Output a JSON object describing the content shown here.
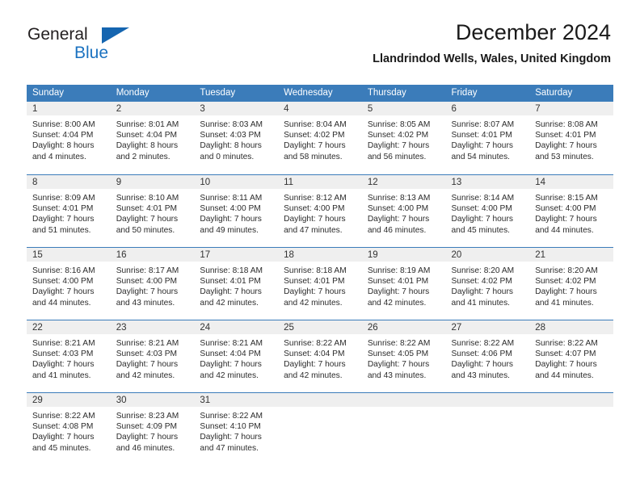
{
  "brand": {
    "word1": "General",
    "word2": "Blue",
    "triangle_color": "#1565b0",
    "word2_color": "#1b72c0"
  },
  "header": {
    "title": "December 2024",
    "subtitle": "Llandrindod Wells, Wales, United Kingdom"
  },
  "colors": {
    "header_bar": "#3b7cba",
    "day_band": "#efefef",
    "row_divider": "#3b7cba",
    "text": "#2b2b2b"
  },
  "weekdays": [
    "Sunday",
    "Monday",
    "Tuesday",
    "Wednesday",
    "Thursday",
    "Friday",
    "Saturday"
  ],
  "labels": {
    "sunrise_prefix": "Sunrise: ",
    "sunset_prefix": "Sunset: ",
    "daylight_prefix": "Daylight: "
  },
  "weeks": [
    [
      {
        "day": "1",
        "sunrise": "Sunrise: 8:00 AM",
        "sunset": "Sunset: 4:04 PM",
        "daylight": "Daylight: 8 hours and 4 minutes."
      },
      {
        "day": "2",
        "sunrise": "Sunrise: 8:01 AM",
        "sunset": "Sunset: 4:04 PM",
        "daylight": "Daylight: 8 hours and 2 minutes."
      },
      {
        "day": "3",
        "sunrise": "Sunrise: 8:03 AM",
        "sunset": "Sunset: 4:03 PM",
        "daylight": "Daylight: 8 hours and 0 minutes."
      },
      {
        "day": "4",
        "sunrise": "Sunrise: 8:04 AM",
        "sunset": "Sunset: 4:02 PM",
        "daylight": "Daylight: 7 hours and 58 minutes."
      },
      {
        "day": "5",
        "sunrise": "Sunrise: 8:05 AM",
        "sunset": "Sunset: 4:02 PM",
        "daylight": "Daylight: 7 hours and 56 minutes."
      },
      {
        "day": "6",
        "sunrise": "Sunrise: 8:07 AM",
        "sunset": "Sunset: 4:01 PM",
        "daylight": "Daylight: 7 hours and 54 minutes."
      },
      {
        "day": "7",
        "sunrise": "Sunrise: 8:08 AM",
        "sunset": "Sunset: 4:01 PM",
        "daylight": "Daylight: 7 hours and 53 minutes."
      }
    ],
    [
      {
        "day": "8",
        "sunrise": "Sunrise: 8:09 AM",
        "sunset": "Sunset: 4:01 PM",
        "daylight": "Daylight: 7 hours and 51 minutes."
      },
      {
        "day": "9",
        "sunrise": "Sunrise: 8:10 AM",
        "sunset": "Sunset: 4:01 PM",
        "daylight": "Daylight: 7 hours and 50 minutes."
      },
      {
        "day": "10",
        "sunrise": "Sunrise: 8:11 AM",
        "sunset": "Sunset: 4:00 PM",
        "daylight": "Daylight: 7 hours and 49 minutes."
      },
      {
        "day": "11",
        "sunrise": "Sunrise: 8:12 AM",
        "sunset": "Sunset: 4:00 PM",
        "daylight": "Daylight: 7 hours and 47 minutes."
      },
      {
        "day": "12",
        "sunrise": "Sunrise: 8:13 AM",
        "sunset": "Sunset: 4:00 PM",
        "daylight": "Daylight: 7 hours and 46 minutes."
      },
      {
        "day": "13",
        "sunrise": "Sunrise: 8:14 AM",
        "sunset": "Sunset: 4:00 PM",
        "daylight": "Daylight: 7 hours and 45 minutes."
      },
      {
        "day": "14",
        "sunrise": "Sunrise: 8:15 AM",
        "sunset": "Sunset: 4:00 PM",
        "daylight": "Daylight: 7 hours and 44 minutes."
      }
    ],
    [
      {
        "day": "15",
        "sunrise": "Sunrise: 8:16 AM",
        "sunset": "Sunset: 4:00 PM",
        "daylight": "Daylight: 7 hours and 44 minutes."
      },
      {
        "day": "16",
        "sunrise": "Sunrise: 8:17 AM",
        "sunset": "Sunset: 4:00 PM",
        "daylight": "Daylight: 7 hours and 43 minutes."
      },
      {
        "day": "17",
        "sunrise": "Sunrise: 8:18 AM",
        "sunset": "Sunset: 4:01 PM",
        "daylight": "Daylight: 7 hours and 42 minutes."
      },
      {
        "day": "18",
        "sunrise": "Sunrise: 8:18 AM",
        "sunset": "Sunset: 4:01 PM",
        "daylight": "Daylight: 7 hours and 42 minutes."
      },
      {
        "day": "19",
        "sunrise": "Sunrise: 8:19 AM",
        "sunset": "Sunset: 4:01 PM",
        "daylight": "Daylight: 7 hours and 42 minutes."
      },
      {
        "day": "20",
        "sunrise": "Sunrise: 8:20 AM",
        "sunset": "Sunset: 4:02 PM",
        "daylight": "Daylight: 7 hours and 41 minutes."
      },
      {
        "day": "21",
        "sunrise": "Sunrise: 8:20 AM",
        "sunset": "Sunset: 4:02 PM",
        "daylight": "Daylight: 7 hours and 41 minutes."
      }
    ],
    [
      {
        "day": "22",
        "sunrise": "Sunrise: 8:21 AM",
        "sunset": "Sunset: 4:03 PM",
        "daylight": "Daylight: 7 hours and 41 minutes."
      },
      {
        "day": "23",
        "sunrise": "Sunrise: 8:21 AM",
        "sunset": "Sunset: 4:03 PM",
        "daylight": "Daylight: 7 hours and 42 minutes."
      },
      {
        "day": "24",
        "sunrise": "Sunrise: 8:21 AM",
        "sunset": "Sunset: 4:04 PM",
        "daylight": "Daylight: 7 hours and 42 minutes."
      },
      {
        "day": "25",
        "sunrise": "Sunrise: 8:22 AM",
        "sunset": "Sunset: 4:04 PM",
        "daylight": "Daylight: 7 hours and 42 minutes."
      },
      {
        "day": "26",
        "sunrise": "Sunrise: 8:22 AM",
        "sunset": "Sunset: 4:05 PM",
        "daylight": "Daylight: 7 hours and 43 minutes."
      },
      {
        "day": "27",
        "sunrise": "Sunrise: 8:22 AM",
        "sunset": "Sunset: 4:06 PM",
        "daylight": "Daylight: 7 hours and 43 minutes."
      },
      {
        "day": "28",
        "sunrise": "Sunrise: 8:22 AM",
        "sunset": "Sunset: 4:07 PM",
        "daylight": "Daylight: 7 hours and 44 minutes."
      }
    ],
    [
      {
        "day": "29",
        "sunrise": "Sunrise: 8:22 AM",
        "sunset": "Sunset: 4:08 PM",
        "daylight": "Daylight: 7 hours and 45 minutes."
      },
      {
        "day": "30",
        "sunrise": "Sunrise: 8:23 AM",
        "sunset": "Sunset: 4:09 PM",
        "daylight": "Daylight: 7 hours and 46 minutes."
      },
      {
        "day": "31",
        "sunrise": "Sunrise: 8:22 AM",
        "sunset": "Sunset: 4:10 PM",
        "daylight": "Daylight: 7 hours and 47 minutes."
      },
      {
        "day": "",
        "sunrise": "",
        "sunset": "",
        "daylight": ""
      },
      {
        "day": "",
        "sunrise": "",
        "sunset": "",
        "daylight": ""
      },
      {
        "day": "",
        "sunrise": "",
        "sunset": "",
        "daylight": ""
      },
      {
        "day": "",
        "sunrise": "",
        "sunset": "",
        "daylight": ""
      }
    ]
  ]
}
